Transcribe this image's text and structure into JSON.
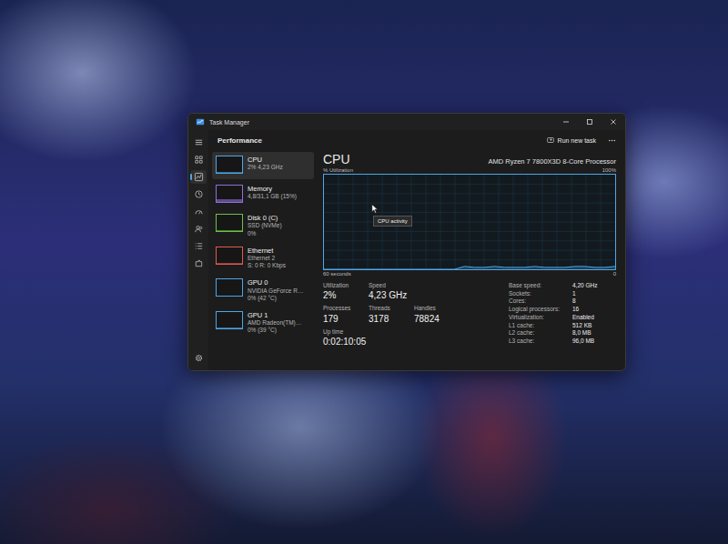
{
  "window": {
    "title": "Task Manager"
  },
  "header": {
    "title": "Performance",
    "action": "Run new task"
  },
  "nav": [
    {
      "selected": false
    },
    {
      "selected": true
    },
    {
      "selected": false
    },
    {
      "selected": false
    },
    {
      "selected": false
    },
    {
      "selected": false
    },
    {
      "selected": false
    }
  ],
  "resources": [
    {
      "name": "CPU",
      "lines": [
        "2% 4,23 GHz"
      ],
      "selected": true,
      "color": "#4ea6e6",
      "level": 0.02
    },
    {
      "name": "Memory",
      "lines": [
        "4,8/31,1 GB (15%)"
      ],
      "selected": false,
      "color": "#8f6fd8",
      "level": 0.15
    },
    {
      "name": "Disk 0 (C)",
      "lines": [
        "SSD (NVMe)",
        "0%"
      ],
      "selected": false,
      "color": "#6cc24a",
      "level": 0
    },
    {
      "name": "Ethernet",
      "lines": [
        "Ethernet 2",
        "S: 0 R: 0 Kbps"
      ],
      "selected": false,
      "color": "#e05a4e",
      "level": 0
    },
    {
      "name": "GPU 0",
      "lines": [
        "NVIDIA GeForce R…",
        "0% (42 °C)"
      ],
      "selected": false,
      "color": "#4ea6e6",
      "level": 0
    },
    {
      "name": "GPU 1",
      "lines": [
        "AMD Radeon(TM)…",
        "0% (39 °C)"
      ],
      "selected": false,
      "color": "#4ea6e6",
      "level": 0
    }
  ],
  "detail": {
    "title": "CPU",
    "device": "AMD Ryzen 7 7800X3D 8-Core Processor",
    "axis": {
      "label": "% Utilization",
      "max": "100%",
      "span": "60 seconds",
      "min": "0"
    },
    "series": [
      0,
      0,
      0,
      0,
      0,
      0,
      0,
      0,
      0,
      0,
      0,
      0,
      0,
      0,
      3,
      2,
      2,
      3,
      2,
      2,
      2,
      3,
      2,
      2,
      2,
      3,
      3,
      2,
      2,
      3
    ],
    "tooltip": "CPU activity",
    "stats": [
      [
        {
          "label": "Utilization",
          "value": "2%"
        },
        {
          "label": "Speed",
          "value": "4,23 GHz"
        }
      ],
      [
        {
          "label": "Processes",
          "value": "179"
        },
        {
          "label": "Threads",
          "value": "3178"
        },
        {
          "label": "Handles",
          "value": "78824"
        }
      ],
      [
        {
          "label": "Up time",
          "value": "0:02:10:05"
        }
      ]
    ],
    "specs": [
      {
        "label": "Base speed:",
        "value": "4,20 GHz"
      },
      {
        "label": "Sockets:",
        "value": "1"
      },
      {
        "label": "Cores:",
        "value": "8"
      },
      {
        "label": "Logical processors:",
        "value": "16"
      },
      {
        "label": "Virtualization:",
        "value": "Enabled"
      },
      {
        "label": "L1 cache:",
        "value": "512 KB"
      },
      {
        "label": "L2 cache:",
        "value": "8,0 MB"
      },
      {
        "label": "L3 cache:",
        "value": "96,0 MB"
      }
    ]
  }
}
